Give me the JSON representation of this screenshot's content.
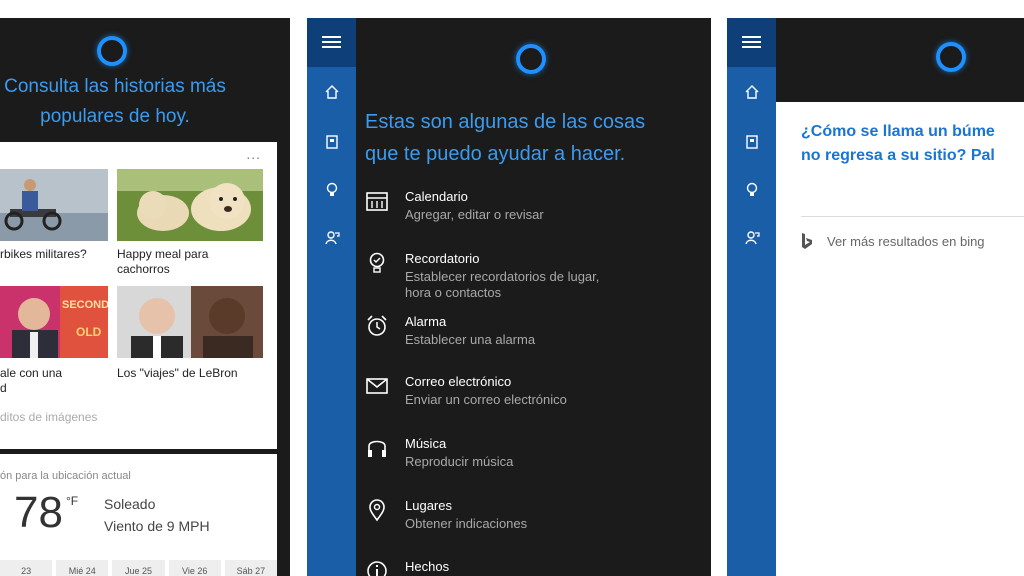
{
  "panel1": {
    "title_line1": "Consulta las historias más",
    "title_line2": "populares de hoy.",
    "news_more": "...",
    "news": [
      {
        "caption_line1": "rbikes militares?",
        "caption_line2": ""
      },
      {
        "caption_line1": "Happy meal para",
        "caption_line2": "cachorros"
      },
      {
        "caption_line1": "ale con una",
        "caption_line2": "d"
      },
      {
        "caption_line1": "Los \"viajes\" de LeBron",
        "caption_line2": ""
      }
    ],
    "news_footer": "ditos de imágenes",
    "weather": {
      "location": "ón para la ubicación actual",
      "temp": "78",
      "unit": "°F",
      "condition": "Soleado",
      "wind": "Viento de 9 MPH",
      "days": [
        "23",
        "Mié 24",
        "Jue 25",
        "Vie 26",
        "Sáb 27"
      ]
    }
  },
  "panel2": {
    "title_line1": "Estas son algunas de las cosas",
    "title_line2": "que te puedo ayudar a hacer.",
    "commands": [
      {
        "name": "Calendario",
        "desc_line1": "Agregar, editar o revisar",
        "desc_line2": "",
        "icon": "calendar-icon"
      },
      {
        "name": "Recordatorio",
        "desc_line1": "Establecer recordatorios de lugar,",
        "desc_line2": "hora o contactos",
        "icon": "reminder-icon"
      },
      {
        "name": "Alarma",
        "desc_line1": "Establecer una alarma",
        "desc_line2": "",
        "icon": "alarm-icon"
      },
      {
        "name": "Correo electrónico",
        "desc_line1": "Enviar un correo electrónico",
        "desc_line2": "",
        "icon": "mail-icon"
      },
      {
        "name": "Música",
        "desc_line1": "Reproducir música",
        "desc_line2": "",
        "icon": "music-icon"
      },
      {
        "name": "Lugares",
        "desc_line1": "Obtener indicaciones",
        "desc_line2": "",
        "icon": "places-icon"
      },
      {
        "name": "Hechos",
        "desc_line1": "",
        "desc_line2": "",
        "icon": "info-icon"
      }
    ]
  },
  "panel3": {
    "question_line1": "¿Cómo se llama un búme",
    "question_line2": "no regresa a su sitio? Pal",
    "bing_text": "Ver más resultados en bing"
  },
  "colors": {
    "cortana_blue": "#1e90ff",
    "rail_blue": "#1a5ea8",
    "dark_bg": "#1b1b1b",
    "title_blue": "#3a9bf0",
    "question_blue": "#1a75d2"
  },
  "rail_icons": [
    "menu-icon",
    "home-icon",
    "notebook-icon",
    "lightbulb-icon",
    "feedback-icon"
  ]
}
